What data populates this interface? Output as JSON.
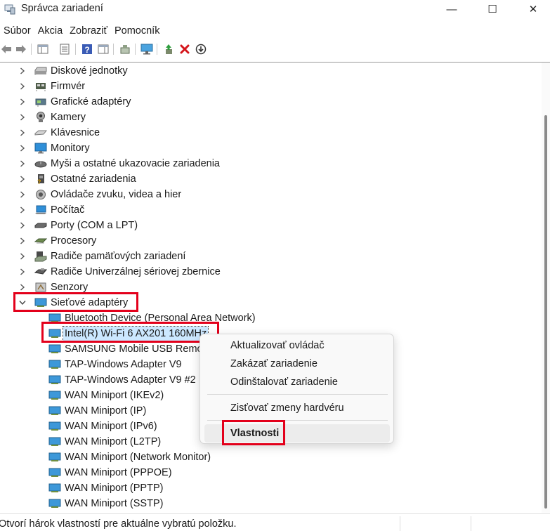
{
  "window": {
    "title": "Správca zariadení",
    "min": "—",
    "max": "☐",
    "close": "✕"
  },
  "menu": [
    "Súbor",
    "Akcia",
    "Zobraziť",
    "Pomocník"
  ],
  "toolbar": [
    "back-icon",
    "forward-icon",
    "show-hide-tree-icon",
    "properties-icon",
    "help-icon",
    "action-pane-icon",
    "scan-hardware-icon",
    "computer-screen-icon",
    "update-driver-icon",
    "uninstall-icon",
    "disable-icon"
  ],
  "tree": {
    "categories": [
      {
        "label": "Diskové jednotky",
        "icon": "disk-icon"
      },
      {
        "label": "Firmvér",
        "icon": "firmware-icon"
      },
      {
        "label": "Grafické adaptéry",
        "icon": "display-adapter-icon"
      },
      {
        "label": "Kamery",
        "icon": "camera-icon"
      },
      {
        "label": "Klávesnice",
        "icon": "keyboard-icon"
      },
      {
        "label": "Monitory",
        "icon": "monitor-icon"
      },
      {
        "label": "Myši a ostatné ukazovacie zariadenia",
        "icon": "mouse-icon"
      },
      {
        "label": "Ostatné zariadenia",
        "icon": "other-device-icon"
      },
      {
        "label": "Ovládače zvuku, videa a hier",
        "icon": "speaker-icon"
      },
      {
        "label": "Počítač",
        "icon": "computer-icon"
      },
      {
        "label": "Porty (COM a LPT)",
        "icon": "port-icon"
      },
      {
        "label": "Procesory",
        "icon": "processor-icon"
      },
      {
        "label": "Radiče pamäťových zariadení",
        "icon": "storage-controller-icon"
      },
      {
        "label": "Radiče Univerzálnej sériovej zbernice",
        "icon": "usb-icon"
      },
      {
        "label": "Senzory",
        "icon": "sensor-icon"
      },
      {
        "label": "Sieťové adaptéry",
        "icon": "network-adapter-icon"
      }
    ],
    "network_children": [
      "Bluetooth Device (Personal Area Network)",
      "Intel(R) Wi-Fi 6 AX201 160MHz",
      "SAMSUNG Mobile USB Remote NDIS Network Device",
      "TAP-Windows Adapter V9",
      "TAP-Windows Adapter V9 #2",
      "WAN Miniport (IKEv2)",
      "WAN Miniport (IP)",
      "WAN Miniport (IPv6)",
      "WAN Miniport (L2TP)",
      "WAN Miniport (Network Monitor)",
      "WAN Miniport (PPPOE)",
      "WAN Miniport (PPTP)",
      "WAN Miniport (SSTP)"
    ]
  },
  "context_menu": {
    "update": "Aktualizovať ovládač",
    "disable": "Zakázať zariadenie",
    "uninstall": "Odinštalovať zariadenie",
    "scan": "Zisťovať zmeny hardvéru",
    "properties": "Vlastnosti"
  },
  "status": {
    "text": "Otvorí hárok vlastností pre aktuálne vybratú položku."
  },
  "colors": {
    "highlight_box": "#e3001b",
    "selection": "#cce8ff"
  }
}
